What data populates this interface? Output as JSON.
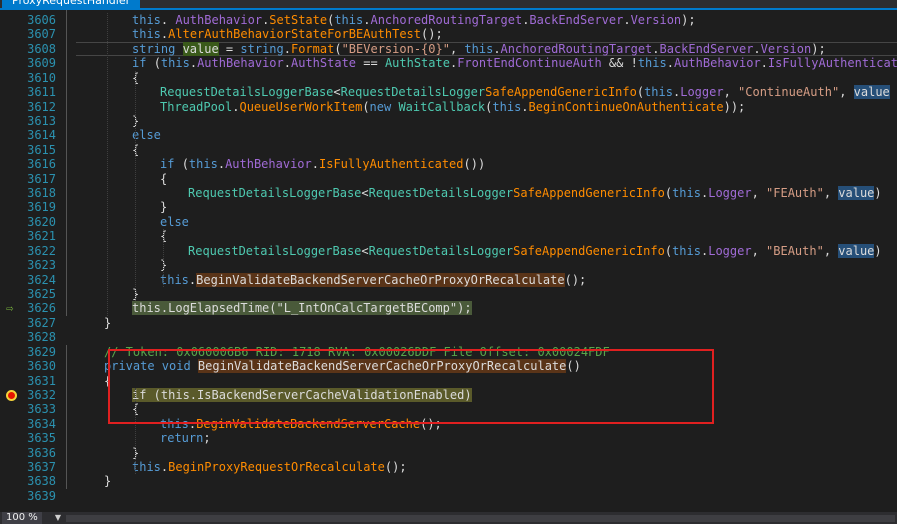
{
  "tab": {
    "title": "ProxyRequestHandler"
  },
  "status": {
    "zoom": "100 %"
  },
  "lines": [
    {
      "n": "3606",
      "i": 3,
      "t": [
        [
          "kw",
          "this"
        ],
        [
          "",
          ". "
        ],
        [
          "pr",
          "AuthBehavior"
        ],
        [
          "",
          "."
        ],
        [
          "me",
          "SetState"
        ],
        [
          "",
          "("
        ],
        [
          "kw",
          "this"
        ],
        [
          "",
          "."
        ],
        [
          "pr",
          "AnchoredRoutingTarget"
        ],
        [
          "",
          "."
        ],
        [
          "pr",
          "BackEndServer"
        ],
        [
          "",
          "."
        ],
        [
          "pr",
          "Version"
        ],
        [
          "",
          ");"
        ]
      ]
    },
    {
      "n": "3607",
      "i": 3,
      "t": [
        [
          "kw",
          "this"
        ],
        [
          "",
          "."
        ],
        [
          "me",
          "AlterAuthBehaviorStateForBEAuthTest"
        ],
        [
          "",
          "();"
        ]
      ]
    },
    {
      "n": "3608",
      "i": 3,
      "t": [
        [
          "kw",
          "string "
        ],
        [
          "hl-green",
          "value"
        ],
        [
          "",
          " = "
        ],
        [
          "kw",
          "string"
        ],
        [
          "",
          "."
        ],
        [
          "me",
          "Format"
        ],
        [
          "",
          "("
        ],
        [
          "str",
          "\"BEVersion-{0}\""
        ],
        [
          "",
          ", "
        ],
        [
          "kw",
          "this"
        ],
        [
          "",
          "."
        ],
        [
          "pr",
          "AnchoredRoutingTarget"
        ],
        [
          "",
          "."
        ],
        [
          "pr",
          "BackEndServer"
        ],
        [
          "",
          "."
        ],
        [
          "pr",
          "Version"
        ],
        [
          "",
          ");"
        ]
      ],
      "cur": true
    },
    {
      "n": "3609",
      "i": 3,
      "t": [
        [
          "kw",
          "if "
        ],
        [
          "",
          "("
        ],
        [
          "kw",
          "this"
        ],
        [
          "",
          "."
        ],
        [
          "pr",
          "AuthBehavior"
        ],
        [
          "",
          "."
        ],
        [
          "pr",
          "AuthState"
        ],
        [
          "",
          " == "
        ],
        [
          "ty",
          "AuthState"
        ],
        [
          "",
          "."
        ],
        [
          "pr",
          "FrontEndContinueAuth"
        ],
        [
          "",
          " && !"
        ],
        [
          "kw",
          "this"
        ],
        [
          "",
          "."
        ],
        [
          "pr",
          "AuthBehavior"
        ],
        [
          "",
          "."
        ],
        [
          "pr",
          "IsFullyAuthenticated"
        ]
      ]
    },
    {
      "n": "3610",
      "i": 3,
      "t": [
        [
          "",
          "{"
        ]
      ]
    },
    {
      "n": "3611",
      "i": 4,
      "t": [
        [
          "ty",
          "RequestDetailsLoggerBase"
        ],
        [
          "",
          "<"
        ],
        [
          "ty",
          "RequestDetailsLogger"
        ],
        [
          ">."
        ],
        [
          "me",
          "SafeAppendGenericInfo"
        ],
        [
          "",
          "("
        ],
        [
          "kw",
          "this"
        ],
        [
          "",
          "."
        ],
        [
          "pr",
          "Logger"
        ],
        [
          "",
          ", "
        ],
        [
          "str",
          "\"ContinueAuth\""
        ],
        [
          "",
          ", "
        ],
        [
          "hl-sel",
          "value"
        ]
      ]
    },
    {
      "n": "3612",
      "i": 4,
      "t": [
        [
          "ty",
          "ThreadPool"
        ],
        [
          "",
          "."
        ],
        [
          "me",
          "QueueUserWorkItem"
        ],
        [
          "",
          "("
        ],
        [
          "kw",
          "new "
        ],
        [
          "ty",
          "WaitCallback"
        ],
        [
          "",
          "("
        ],
        [
          "kw",
          "this"
        ],
        [
          "",
          "."
        ],
        [
          "me",
          "BeginContinueOnAuthenticate"
        ],
        [
          "",
          "));"
        ]
      ]
    },
    {
      "n": "3613",
      "i": 3,
      "t": [
        [
          "",
          "}"
        ]
      ]
    },
    {
      "n": "3614",
      "i": 3,
      "t": [
        [
          "kw",
          "else"
        ]
      ]
    },
    {
      "n": "3615",
      "i": 3,
      "t": [
        [
          "",
          "{"
        ]
      ]
    },
    {
      "n": "3616",
      "i": 4,
      "t": [
        [
          "kw",
          "if "
        ],
        [
          "",
          "("
        ],
        [
          "kw",
          "this"
        ],
        [
          "",
          "."
        ],
        [
          "pr",
          "AuthBehavior"
        ],
        [
          "",
          "."
        ],
        [
          "me",
          "IsFullyAuthenticated"
        ],
        [
          "",
          "())"
        ]
      ]
    },
    {
      "n": "3617",
      "i": 4,
      "t": [
        [
          "",
          "{"
        ]
      ]
    },
    {
      "n": "3618",
      "i": 5,
      "t": [
        [
          "ty",
          "RequestDetailsLoggerBase"
        ],
        [
          "",
          "<"
        ],
        [
          "ty",
          "RequestDetailsLogger"
        ],
        [
          ">."
        ],
        [
          "me",
          "SafeAppendGenericInfo"
        ],
        [
          "",
          "("
        ],
        [
          "kw",
          "this"
        ],
        [
          "",
          "."
        ],
        [
          "pr",
          "Logger"
        ],
        [
          "",
          ", "
        ],
        [
          "str",
          "\"FEAuth\""
        ],
        [
          "",
          ", "
        ],
        [
          "hl-sel",
          "value"
        ],
        [
          "",
          ")"
        ]
      ]
    },
    {
      "n": "3619",
      "i": 4,
      "t": [
        [
          "",
          "}"
        ]
      ]
    },
    {
      "n": "3620",
      "i": 4,
      "t": [
        [
          "kw",
          "else"
        ]
      ]
    },
    {
      "n": "3621",
      "i": 4,
      "t": [
        [
          "",
          "{"
        ]
      ]
    },
    {
      "n": "3622",
      "i": 5,
      "t": [
        [
          "ty",
          "RequestDetailsLoggerBase"
        ],
        [
          "",
          "<"
        ],
        [
          "ty",
          "RequestDetailsLogger"
        ],
        [
          ">."
        ],
        [
          "me",
          "SafeAppendGenericInfo"
        ],
        [
          "",
          "("
        ],
        [
          "kw",
          "this"
        ],
        [
          "",
          "."
        ],
        [
          "pr",
          "Logger"
        ],
        [
          "",
          ", "
        ],
        [
          "str",
          "\"BEAuth\""
        ],
        [
          "",
          ", "
        ],
        [
          "hl-sel",
          "value"
        ],
        [
          "",
          ")"
        ]
      ]
    },
    {
      "n": "3623",
      "i": 4,
      "t": [
        [
          "",
          "}"
        ]
      ]
    },
    {
      "n": "3624",
      "i": 4,
      "t": [
        [
          "kw",
          "this"
        ],
        [
          "",
          "."
        ],
        [
          "hl-orange",
          "BeginValidateBackendServerCacheOrProxyOrRecalculate"
        ],
        [
          "",
          "();"
        ]
      ]
    },
    {
      "n": "3625",
      "i": 3,
      "t": [
        [
          "",
          "}"
        ]
      ]
    },
    {
      "n": "3626",
      "i": 3,
      "t": [
        [
          "hl-exec",
          "this.LogElapsedTime(\"L_IntOnCalcTargetBEComp\");"
        ]
      ],
      "exec": true
    },
    {
      "n": "3627",
      "i": 2,
      "t": [
        [
          "",
          "}"
        ]
      ]
    },
    {
      "n": "3628",
      "i": 2,
      "t": []
    },
    {
      "n": "3629",
      "i": 2,
      "t": [
        [
          "cm",
          "// Token: 0x060006B6 RID: 1718 RVA: 0x00026DDF File Offset: 0x00024FDF"
        ]
      ]
    },
    {
      "n": "3630",
      "i": 2,
      "t": [
        [
          "kw",
          "private void "
        ],
        [
          "hl-orange",
          "BeginValidateBackendServerCacheOrProxyOrRecalculate"
        ],
        [
          "",
          "()"
        ]
      ]
    },
    {
      "n": "3631",
      "i": 2,
      "t": [
        [
          "",
          "{"
        ]
      ]
    },
    {
      "n": "3632",
      "i": 3,
      "t": [
        [
          "hl-yellow",
          "if (this.IsBackendServerCacheValidationEnabled)"
        ]
      ],
      "bp": true
    },
    {
      "n": "3633",
      "i": 3,
      "t": [
        [
          "",
          "{"
        ]
      ]
    },
    {
      "n": "3634",
      "i": 4,
      "t": [
        [
          "kw",
          "this"
        ],
        [
          "",
          "."
        ],
        [
          "me",
          "BeginValidateBackendServerCache"
        ],
        [
          "",
          "();"
        ]
      ]
    },
    {
      "n": "3635",
      "i": 4,
      "t": [
        [
          "kw",
          "return"
        ],
        [
          "",
          ";"
        ]
      ]
    },
    {
      "n": "3636",
      "i": 3,
      "t": [
        [
          "",
          "}"
        ]
      ]
    },
    {
      "n": "3637",
      "i": 3,
      "t": [
        [
          "kw",
          "this"
        ],
        [
          "",
          "."
        ],
        [
          "me",
          "BeginProxyRequestOrRecalculate"
        ],
        [
          "",
          "();"
        ]
      ]
    },
    {
      "n": "3638",
      "i": 2,
      "t": [
        [
          "",
          "}"
        ]
      ]
    },
    {
      "n": "3639",
      "i": 2,
      "t": []
    }
  ]
}
